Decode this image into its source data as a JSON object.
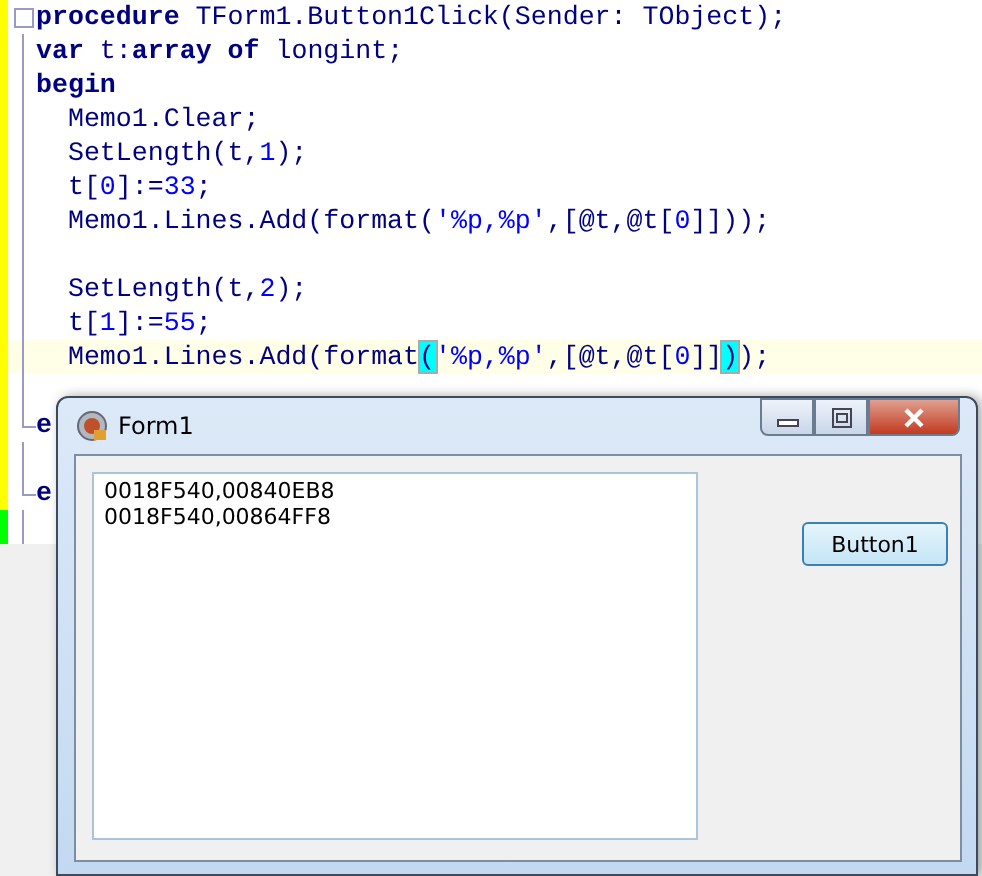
{
  "editor": {
    "lines": [
      {
        "saved": false,
        "current": false,
        "fold_start": true,
        "tokens": [
          {
            "kind": "keyword",
            "text": "procedure"
          },
          {
            "kind": "plain",
            "text": " TForm1.Button1Click(Sender: TObject);"
          }
        ]
      },
      {
        "saved": false,
        "current": false,
        "tokens": [
          {
            "kind": "keyword",
            "text": "var"
          },
          {
            "kind": "plain",
            "text": " t:"
          },
          {
            "kind": "keyword",
            "text": "array"
          },
          {
            "kind": "keyword",
            "text": "of",
            "gap": true
          },
          {
            "kind": "plain",
            "text": " longint;"
          }
        ]
      },
      {
        "saved": false,
        "current": false,
        "tokens": [
          {
            "kind": "keyword",
            "text": "begin"
          }
        ]
      },
      {
        "saved": false,
        "current": false,
        "tokens": [
          {
            "kind": "plain",
            "text": "  Memo1.Clear;"
          }
        ]
      },
      {
        "saved": false,
        "current": false,
        "tokens": [
          {
            "kind": "plain",
            "text": "  SetLength(t,"
          },
          {
            "kind": "number",
            "text": "1"
          },
          {
            "kind": "plain",
            "text": ");"
          }
        ]
      },
      {
        "saved": false,
        "current": false,
        "tokens": [
          {
            "kind": "plain",
            "text": "  t["
          },
          {
            "kind": "number",
            "text": "0"
          },
          {
            "kind": "plain",
            "text": "]:="
          },
          {
            "kind": "number",
            "text": "33"
          },
          {
            "kind": "plain",
            "text": ";"
          }
        ]
      },
      {
        "saved": false,
        "current": false,
        "tokens": [
          {
            "kind": "plain",
            "text": "  Memo1.Lines.Add(format("
          },
          {
            "kind": "string",
            "text": "'%p,%p'"
          },
          {
            "kind": "plain",
            "text": ",[@t,@t["
          },
          {
            "kind": "number",
            "text": "0"
          },
          {
            "kind": "plain",
            "text": "]]));"
          }
        ]
      },
      {
        "saved": false,
        "current": false
      },
      {
        "saved": false,
        "current": false,
        "tokens": [
          {
            "kind": "plain",
            "text": "  SetLength(t,"
          },
          {
            "kind": "number",
            "text": "2"
          },
          {
            "kind": "plain",
            "text": ");"
          }
        ]
      },
      {
        "saved": false,
        "current": false,
        "tokens": [
          {
            "kind": "plain",
            "text": "  t["
          },
          {
            "kind": "number",
            "text": "1"
          },
          {
            "kind": "plain",
            "text": "]:="
          },
          {
            "kind": "number",
            "text": "55"
          },
          {
            "kind": "plain",
            "text": ";"
          }
        ]
      },
      {
        "saved": false,
        "current": true,
        "tokens": [
          {
            "kind": "plain",
            "text": "  Memo1.Lines.Add(format"
          },
          {
            "kind": "brace",
            "text": "("
          },
          {
            "kind": "string",
            "text": "'%p,%p'"
          },
          {
            "kind": "plain",
            "text": ",[@t,@t["
          },
          {
            "kind": "number",
            "text": "0"
          },
          {
            "kind": "plain",
            "text": "]]"
          },
          {
            "kind": "brace",
            "text": ")"
          },
          {
            "kind": "plain",
            "text": ");"
          }
        ]
      },
      {
        "saved": false,
        "current": false
      },
      {
        "saved": false,
        "current": false,
        "fold_end": true,
        "tokens": [
          {
            "kind": "keyword",
            "text": "e"
          }
        ]
      },
      {
        "saved": false,
        "current": false
      },
      {
        "saved": false,
        "current": false,
        "fold_end": true,
        "tokens": [
          {
            "kind": "keyword",
            "text": "e"
          }
        ]
      },
      {
        "saved": true,
        "current": false
      }
    ]
  },
  "form": {
    "title": "Form1",
    "memo_lines": [
      "0018F540,00840EB8",
      "0018F540,00864FF8"
    ],
    "button": "Button1"
  }
}
